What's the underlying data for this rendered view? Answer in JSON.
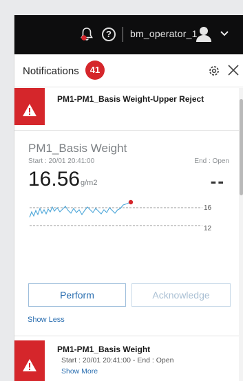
{
  "header": {
    "username": "bm_operator_1",
    "help_glyph": "?",
    "icons": [
      "bell-alert-icon",
      "help-icon",
      "user-avatar-icon",
      "chevron-down-icon"
    ]
  },
  "notifications": {
    "title": "Notifications",
    "count": "41",
    "badge_color": "#d5262b",
    "icons": [
      "gear-icon",
      "close-icon"
    ]
  },
  "alerts": [
    {
      "title": "PM1-PM1_Basis Weight-Upper Reject",
      "severity_color": "#d5262b",
      "icon": "warning-triangle-icon"
    },
    {
      "title": "PM1-PM1_Basis Weight",
      "start_end": "Start : 20/01 20:41:00  -  End : Open",
      "show_more": "Show More",
      "severity_color": "#d5262b",
      "icon": "warning-triangle-icon"
    }
  ],
  "detail": {
    "metric_name": "PM1_Basis Weight",
    "start": "Start : 20/01 20:41:00",
    "end": "End : Open",
    "value": "16.56",
    "unit": "g/m2",
    "secondary_value": "--",
    "limit_high": "16",
    "limit_low": "12",
    "perform_label": "Perform",
    "acknowledge_label": "Acknowledge",
    "show_less": "Show Less"
  }
}
